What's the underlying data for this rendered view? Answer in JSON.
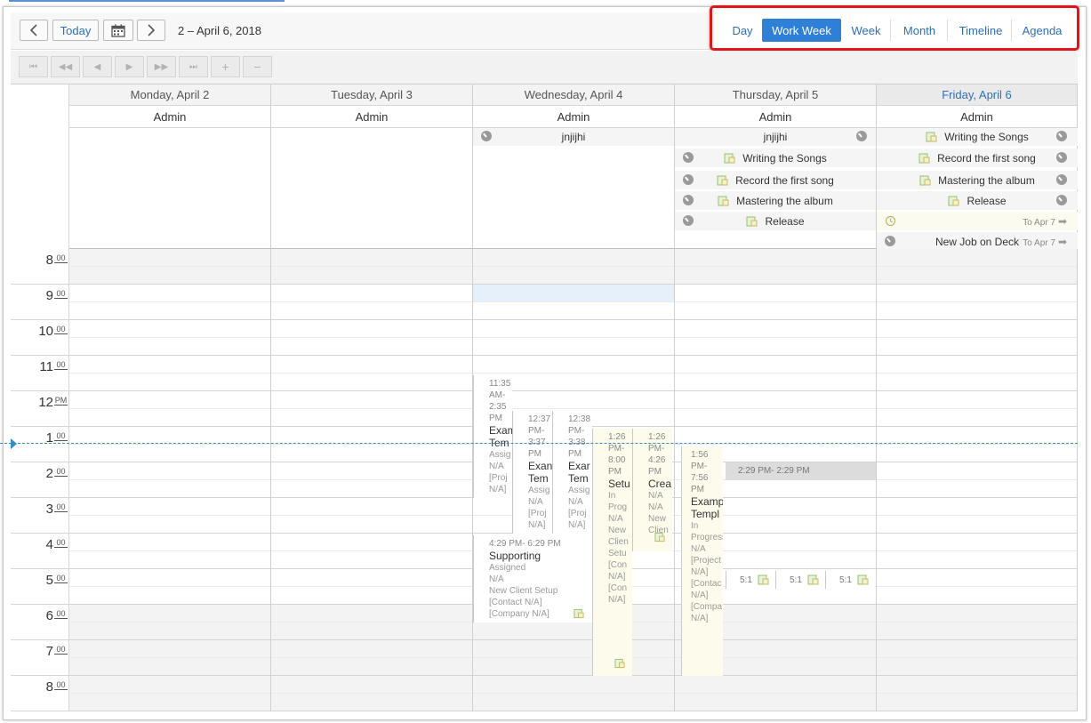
{
  "toolbar": {
    "prev_label": "‹",
    "today_label": "Today",
    "calendar_icon": "calendar-icon",
    "next_label": "›",
    "date_range": "2 – April 6, 2018"
  },
  "views": [
    {
      "label": "Day",
      "active": false
    },
    {
      "label": "Work Week",
      "active": true
    },
    {
      "label": "Week",
      "active": false
    },
    {
      "label": "Month",
      "active": false
    },
    {
      "label": "Timeline",
      "active": false
    },
    {
      "label": "Agenda",
      "active": false
    }
  ],
  "nav_buttons": [
    "first-icon",
    "fast-back-icon",
    "back-icon",
    "forward-icon",
    "fast-forward-icon",
    "last-icon",
    "plus-icon",
    "minus-icon"
  ],
  "days": [
    {
      "label": "Monday, April 2",
      "resource": "Admin",
      "today": false
    },
    {
      "label": "Tuesday, April 3",
      "resource": "Admin",
      "today": false
    },
    {
      "label": "Wednesday, April 4",
      "resource": "Admin",
      "today": false
    },
    {
      "label": "Thursday, April 5",
      "resource": "Admin",
      "today": false
    },
    {
      "label": "Friday, April 6",
      "resource": "Admin",
      "today": true
    }
  ],
  "allday_events": {
    "wed": [
      {
        "title": "jnjijhi"
      }
    ],
    "thu": [
      {
        "title": "jnjijhi"
      },
      {
        "title": "Writing the Songs"
      },
      {
        "title": "Record the first song"
      },
      {
        "title": "Mastering the album"
      },
      {
        "title": "Release"
      }
    ],
    "fri": [
      {
        "title": "Writing the Songs"
      },
      {
        "title": "Record the first song"
      },
      {
        "title": "Mastering the album"
      },
      {
        "title": "Release"
      },
      {
        "title": "",
        "continues": "To Apr 7"
      },
      {
        "title": "New Job on Deck",
        "continues": "To Apr 7"
      }
    ]
  },
  "hours": [
    {
      "num": "8",
      "min": "00"
    },
    {
      "num": "9",
      "min": "00"
    },
    {
      "num": "10",
      "min": "00"
    },
    {
      "num": "11",
      "min": "00"
    },
    {
      "num": "12",
      "min": "PM"
    },
    {
      "num": "1",
      "min": "00"
    },
    {
      "num": "2",
      "min": "00"
    },
    {
      "num": "3",
      "min": "00"
    },
    {
      "num": "4",
      "min": "00"
    },
    {
      "num": "5",
      "min": "00"
    },
    {
      "num": "6",
      "min": "00"
    },
    {
      "num": "7",
      "min": "00"
    },
    {
      "num": "8",
      "min": "00"
    }
  ],
  "timed_events": {
    "e1": {
      "time": "11:35 AM- 2:35 PM",
      "title": "Exam Tem",
      "lines": [
        "Assig",
        "N/A",
        "[Proj",
        "N/A]"
      ]
    },
    "e2": {
      "time": "12:37 PM- 3:37 PM",
      "title": "Exan Tem",
      "lines": [
        "Assig",
        "N/A",
        "[Proj",
        "N/A]"
      ]
    },
    "e3": {
      "time": "12:38 PM- 3:38 PM",
      "title": "Exar Tem",
      "lines": [
        "Assig",
        "N/A",
        "[Proj",
        "N/A]"
      ]
    },
    "e4": {
      "time": "1:26 PM- 8:00 PM",
      "title": "Setu",
      "lines": [
        "In Prog",
        "N/A",
        "New Clien",
        "Setu",
        "[Con",
        "N/A]",
        "[Con",
        "N/A]"
      ]
    },
    "e5": {
      "time": "1:26 PM- 4:26 PM",
      "title": "Crea",
      "lines": [
        "N/A",
        "N/A",
        "New",
        "Clien"
      ]
    },
    "e6": {
      "time": "4:29 PM- 6:29 PM",
      "title": "Supporting",
      "lines": [
        "Assigned",
        "N/A",
        "New Client Setup",
        "[Contact N/A]",
        "[Company N/A]"
      ]
    },
    "e7": {
      "time": "1:56 PM- 7:56 PM",
      "title": "Example Templ",
      "lines": [
        "In Progress",
        "N/A",
        "[Project",
        "N/A]",
        "[Contac",
        "N/A]",
        "[Compa",
        "N/A]"
      ]
    },
    "e8": {
      "time": "2:29 PM- 2:29 PM"
    },
    "chips": [
      "5:1",
      "5:1",
      "5:1"
    ]
  }
}
